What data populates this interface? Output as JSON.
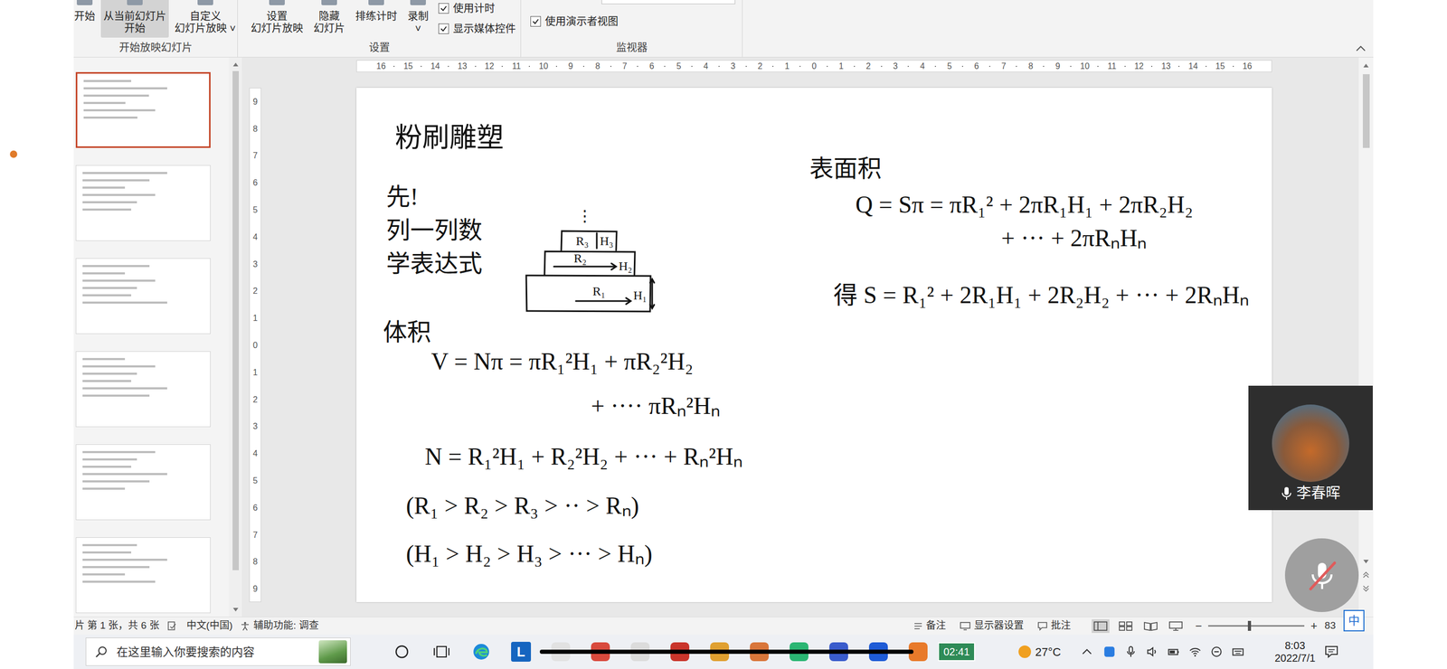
{
  "ribbon": {
    "groups": [
      {
        "label": "开始放映幻灯片",
        "buttons": [
          {
            "lines": [
              "开始"
            ],
            "highlighted": false
          },
          {
            "lines": [
              "从当前幻灯片",
              "开始"
            ],
            "highlighted": true
          },
          {
            "lines": [
              "自定义",
              "幻灯片放映 ˅"
            ],
            "highlighted": false
          }
        ],
        "checkboxes": []
      },
      {
        "label": "设置",
        "buttons": [
          {
            "lines": [
              "设置",
              "幻灯片放映"
            ],
            "highlighted": false
          },
          {
            "lines": [
              "隐藏",
              "幻灯片"
            ],
            "highlighted": false
          },
          {
            "lines": [
              "排练计时"
            ],
            "highlighted": false
          },
          {
            "lines": [
              "录制",
              "˅"
            ],
            "highlighted": false
          }
        ],
        "checkboxes": [
          {
            "label": "使用计时",
            "checked": true
          },
          {
            "label": "显示媒体控件",
            "checked": true
          }
        ]
      },
      {
        "label": "监视器",
        "buttons": [],
        "checkboxes": [
          {
            "label": "使用演示者视图",
            "checked": true
          }
        ]
      }
    ]
  },
  "thumbnails": [
    {
      "selected": true
    },
    {
      "selected": false
    },
    {
      "selected": false
    },
    {
      "selected": false
    },
    {
      "selected": false
    },
    {
      "selected": false
    }
  ],
  "ruler": {
    "horizontal": [
      "16",
      "15",
      "14",
      "13",
      "12",
      "11",
      "10",
      "9",
      "8",
      "7",
      "6",
      "5",
      "4",
      "3",
      "2",
      "1",
      "0",
      "1",
      "2",
      "3",
      "4",
      "5",
      "6",
      "7",
      "8",
      "9",
      "10",
      "11",
      "12",
      "13",
      "14",
      "15",
      "16"
    ],
    "vertical": [
      "9",
      "8",
      "7",
      "6",
      "5",
      "4",
      "3",
      "2",
      "1",
      "0",
      "1",
      "2",
      "3",
      "4",
      "5",
      "6",
      "7",
      "8",
      "9"
    ]
  },
  "slide": {
    "title": "粉刷雕塑",
    "intro": [
      "先!",
      "列一列数",
      "学表达式"
    ],
    "diagram": {
      "dots": "⋮",
      "layers": [
        {
          "r": "R₃",
          "h": "H₃"
        },
        {
          "r": "R₂",
          "h": "H₂"
        },
        {
          "r": "R₁",
          "h": "H₁"
        }
      ]
    },
    "volume": {
      "heading": "体积",
      "lines": [
        "V = Nπ = πR₁²H₁ + πR₂²H₂",
        "+ ···· πRₙ²Hₙ",
        "N = R₁²H₁ + R₂²H₂ + ··· + Rₙ²Hₙ",
        "(R₁ > R₂ > R₃ > ·· > Rₙ)",
        "(H₁ > H₂ > H₃ > ··· > Hₙ)"
      ]
    },
    "area": {
      "heading": "表面积",
      "lines": [
        "Q = Sπ = πR₁² + 2πR₁H₁ + 2πR₂H₂",
        "+ ··· + 2πRₙHₙ",
        "得 S = R₁² + 2R₁H₁ + 2R₂H₂ + ··· + 2RₙHₙ"
      ]
    }
  },
  "status_bar": {
    "slide": "片 第 1 张，共 6 张",
    "language": "中文(中国)",
    "accessibility": "辅助功能: 调查",
    "notes": "备注",
    "display": "显示器设置",
    "comments": "批注",
    "zoom_minus": "−",
    "zoom_plus": "+",
    "zoom_level": 0.43,
    "zoom": "83"
  },
  "taskbar": {
    "search_placeholder": "在这里输入你要搜索的内容",
    "app_letter": "L",
    "video_time": "02:41",
    "video_progress": 1,
    "weather": "27°C",
    "time": "8:03",
    "date": "2022/7/1",
    "ime": "中"
  },
  "call": {
    "name": "李春晖",
    "muted": true
  }
}
